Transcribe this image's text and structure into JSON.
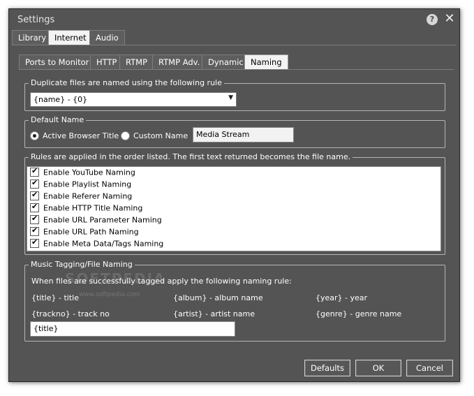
{
  "window": {
    "title": "Settings"
  },
  "tabs_main": [
    {
      "label": "Library",
      "active": false
    },
    {
      "label": "Internet",
      "active": true
    },
    {
      "label": "Audio",
      "active": false
    }
  ],
  "tabs_sub": [
    {
      "label": "Ports to Monitor",
      "active": false
    },
    {
      "label": "HTTP",
      "active": false
    },
    {
      "label": "RTMP",
      "active": false
    },
    {
      "label": "RTMP Adv.",
      "active": false
    },
    {
      "label": "Dynamic",
      "active": false
    },
    {
      "label": "Naming",
      "active": true
    }
  ],
  "duplicate": {
    "legend": "Duplicate files are named using the following rule",
    "value": "{name} - {0}"
  },
  "default_name": {
    "legend": "Default Name",
    "options": [
      {
        "label": "Active Browser Title",
        "selected": true
      },
      {
        "label": "Custom Name",
        "selected": false
      }
    ],
    "custom_value": "Media Stream"
  },
  "rules": {
    "legend": "Rules are applied in the order listed.  The first text returned becomes the file name.",
    "items": [
      {
        "label": "Enable YouTube Naming",
        "checked": true
      },
      {
        "label": "Enable Playlist Naming",
        "checked": true
      },
      {
        "label": "Enable Referer Naming",
        "checked": true
      },
      {
        "label": "Enable HTTP Title Naming",
        "checked": true
      },
      {
        "label": "Enable URL Parameter Naming",
        "checked": true
      },
      {
        "label": "Enable URL Path Naming",
        "checked": true
      },
      {
        "label": "Enable Meta Data/Tags Naming",
        "checked": true
      }
    ]
  },
  "music": {
    "legend": "Music Tagging/File Naming",
    "description": "When files are successfully tagged apply the following naming rule:",
    "tokens": [
      "{title} - title",
      "{album} - album name",
      "{year} - year",
      "{trackno} - track no",
      "{artist} - artist name",
      "{genre} - genre name"
    ],
    "value": "{title}"
  },
  "watermark": {
    "main": "SOFTPEDIA",
    "sub": "www.softpedia.com"
  },
  "buttons": {
    "defaults": "Defaults",
    "ok": "OK",
    "cancel": "Cancel"
  },
  "icons": {
    "help": "question-icon",
    "close": "close-icon",
    "dropdown": "chevron-down-icon"
  }
}
